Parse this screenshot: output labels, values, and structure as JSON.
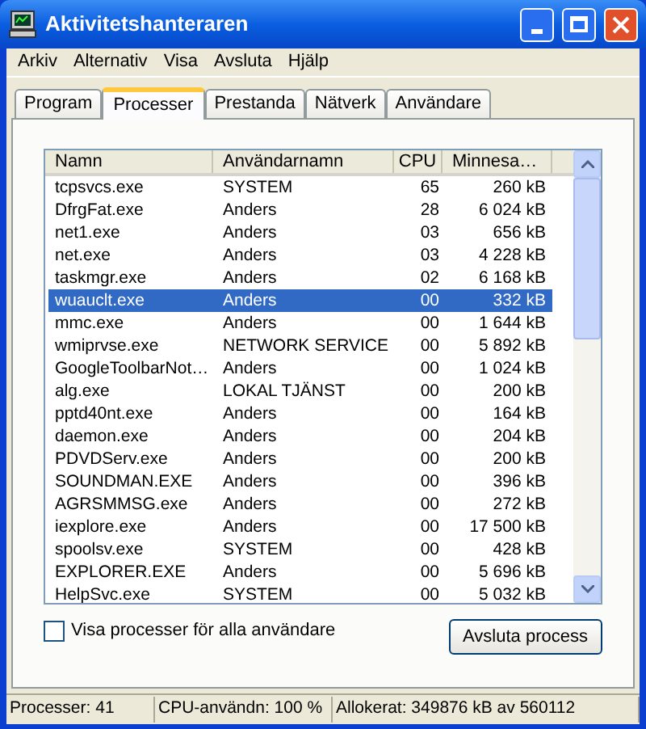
{
  "window": {
    "title": "Aktivitetshanteraren"
  },
  "menu": [
    "Arkiv",
    "Alternativ",
    "Visa",
    "Avsluta",
    "Hjälp"
  ],
  "tabs": [
    {
      "label": "Program",
      "selected": false
    },
    {
      "label": "Processer",
      "selected": true
    },
    {
      "label": "Prestanda",
      "selected": false
    },
    {
      "label": "Nätverk",
      "selected": false
    },
    {
      "label": "Användare",
      "selected": false
    }
  ],
  "table": {
    "columns": [
      "Namn",
      "Användarnamn",
      "CPU",
      "Minnesa…"
    ],
    "rows": [
      {
        "cells": [
          "tcpsvcs.exe",
          "SYSTEM",
          "65",
          "260 kB"
        ],
        "selected": false
      },
      {
        "cells": [
          "DfrgFat.exe",
          "Anders",
          "28",
          "6 024 kB"
        ],
        "selected": false
      },
      {
        "cells": [
          "net1.exe",
          "Anders",
          "03",
          "656 kB"
        ],
        "selected": false
      },
      {
        "cells": [
          "net.exe",
          "Anders",
          "03",
          "4 228 kB"
        ],
        "selected": false
      },
      {
        "cells": [
          "taskmgr.exe",
          "Anders",
          "02",
          "6 168 kB"
        ],
        "selected": false
      },
      {
        "cells": [
          "wuauclt.exe",
          "Anders",
          "00",
          "332 kB"
        ],
        "selected": true
      },
      {
        "cells": [
          "mmc.exe",
          "Anders",
          "00",
          "1 644 kB"
        ],
        "selected": false
      },
      {
        "cells": [
          "wmiprvse.exe",
          "NETWORK SERVICE",
          "00",
          "5 892 kB"
        ],
        "selected": false
      },
      {
        "cells": [
          "GoogleToolbarNot…",
          "Anders",
          "00",
          "1 024 kB"
        ],
        "selected": false
      },
      {
        "cells": [
          "alg.exe",
          "LOKAL TJÄNST",
          "00",
          "200 kB"
        ],
        "selected": false
      },
      {
        "cells": [
          "pptd40nt.exe",
          "Anders",
          "00",
          "164 kB"
        ],
        "selected": false
      },
      {
        "cells": [
          "daemon.exe",
          "Anders",
          "00",
          "204 kB"
        ],
        "selected": false
      },
      {
        "cells": [
          "PDVDServ.exe",
          "Anders",
          "00",
          "200 kB"
        ],
        "selected": false
      },
      {
        "cells": [
          "SOUNDMAN.EXE",
          "Anders",
          "00",
          "396 kB"
        ],
        "selected": false
      },
      {
        "cells": [
          "AGRSMMSG.exe",
          "Anders",
          "00",
          "272 kB"
        ],
        "selected": false
      },
      {
        "cells": [
          "iexplore.exe",
          "Anders",
          "00",
          "17 500 kB"
        ],
        "selected": false
      },
      {
        "cells": [
          "spoolsv.exe",
          "SYSTEM",
          "00",
          "428 kB"
        ],
        "selected": false
      },
      {
        "cells": [
          "EXPLORER.EXE",
          "Anders",
          "00",
          "5 696 kB"
        ],
        "selected": false
      },
      {
        "cells": [
          "HelpSvc.exe",
          "SYSTEM",
          "00",
          "5 032 kB"
        ],
        "selected": false
      }
    ]
  },
  "show_all_users": {
    "label": "Visa processer för alla användare",
    "checked": false
  },
  "end_process_button": "Avsluta process",
  "status_bar": [
    "Processer: 41",
    "CPU-användn: 100 %",
    "Allokerat: 349876 kB av 560112"
  ]
}
